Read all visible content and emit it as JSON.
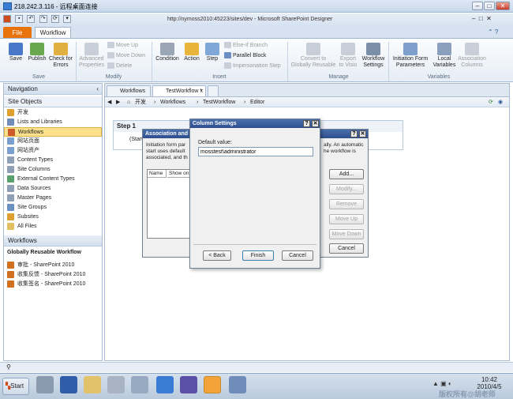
{
  "rdp": {
    "title": "218.242.3.116 - 远程桌面连接"
  },
  "spd": {
    "url": "http://nymoss2010:45223/sites/dev - Microsoft SharePoint Designer"
  },
  "tabs": {
    "file": "File",
    "workflow": "Workflow"
  },
  "ribbon": {
    "save": {
      "save": "Save",
      "publish": "Publish",
      "check": "Check for Errors",
      "label": "Save"
    },
    "modify": {
      "adv": "Advanced Properties",
      "up": "Move Up",
      "down": "Move Down",
      "del": "Delete",
      "label": "Modify"
    },
    "insert": {
      "cond": "Condition",
      "action": "Action",
      "step": "Step",
      "elseif": "Else-If Branch",
      "parallel": "Parallel Block",
      "imp": "Impersonation Step",
      "label": "Insert"
    },
    "manage": {
      "convert": "Convert to Globally Reusable",
      "export": "Export to Visio",
      "settings": "Workflow Settings",
      "label": "Manage"
    },
    "variables": {
      "init": "Initiation Form Parameters",
      "local": "Local Variables",
      "assoc": "Association Columns",
      "label": "Variables"
    }
  },
  "nav": {
    "header": "Navigation",
    "site_objects": "Site Objects",
    "items": [
      "开发",
      "Lists and Libraries",
      "Workflows",
      "网站页面",
      "网站资产",
      "Content Types",
      "Site Columns",
      "External Content Types",
      "Data Sources",
      "Master Pages",
      "Site Groups",
      "Subsites",
      "All Files"
    ],
    "wf_header": "Workflows",
    "reusable": "Globally Reusable Workflow",
    "wf_items": [
      "审批 - SharePoint 2010",
      "收集反馈 - SharePoint 2010",
      "收集签名 - SharePoint 2010"
    ]
  },
  "doc": {
    "tab1": "Workflows",
    "tab2": "TestWorkflow *",
    "crumb": [
      "开发",
      "Workflows",
      "TestWorkflow",
      "Editor"
    ],
    "step": "Step 1",
    "start": "(Start"
  },
  "assoc": {
    "title": "Association and",
    "text1": "Initiation form par",
    "text1b": "ally. An automatic",
    "text2": "start uses default",
    "text2b": "he workflow is",
    "text3": "associated, and th",
    "col_name": "Name",
    "col_show": "Show on",
    "add": "Add...",
    "modify": "Modify...",
    "remove": "Remove",
    "up": "Move Up",
    "down": "Move Down",
    "cancel": "Cancel"
  },
  "col": {
    "title": "Column Settings",
    "label": "Default value:",
    "value": "mosstest\\administrator",
    "back": "< Back",
    "finish": "Finish",
    "cancel": "Cancel"
  },
  "taskbar": {
    "start": "Start",
    "time": "10:42",
    "date": "2010/4/5",
    "watermark": "版权所有@胡老师"
  }
}
